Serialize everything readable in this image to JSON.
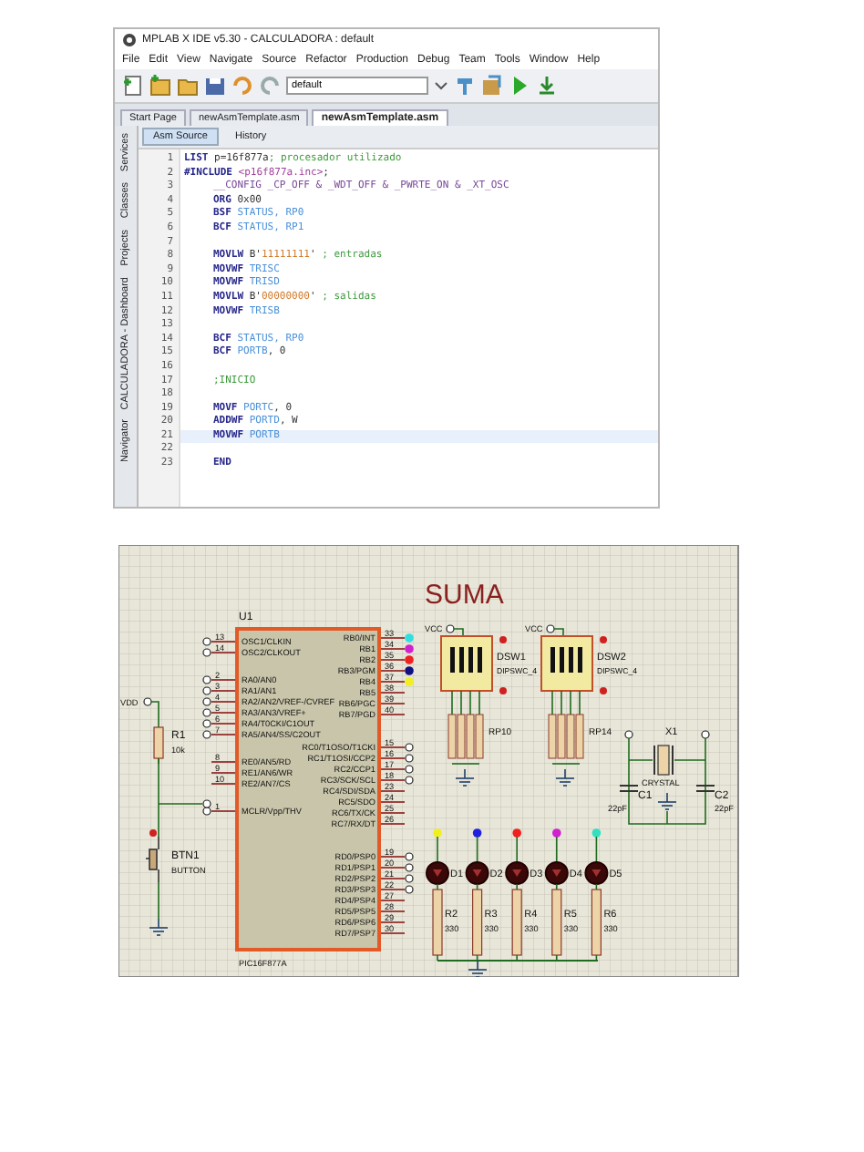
{
  "ide": {
    "title": "MPLAB X IDE v5.30 - CALCULADORA : default",
    "menu": [
      "File",
      "Edit",
      "View",
      "Navigate",
      "Source",
      "Refactor",
      "Production",
      "Debug",
      "Team",
      "Tools",
      "Window",
      "Help"
    ],
    "config_field": {
      "value": "default"
    },
    "file_tabs": [
      {
        "label": "Start Page",
        "selected": false
      },
      {
        "label": "newAsmTemplate.asm",
        "selected": false
      },
      {
        "label": "newAsmTemplate.asm",
        "selected": true
      }
    ],
    "view_tabs": [
      {
        "label": "Asm Source",
        "selected": true
      },
      {
        "label": "History",
        "selected": false
      }
    ],
    "side_tabs": [
      "Services",
      "Classes",
      "Projects",
      "CALCULADORA - Dashboard",
      "Navigator"
    ],
    "code_lines": [
      {
        "number": "1",
        "indent": false,
        "selected": false,
        "tokens": [
          {
            "kind": "keyword",
            "text": "LIST"
          },
          {
            "kind": "plain",
            "text": " p=16f877a"
          },
          {
            "kind": "comment",
            "text": "; procesador utilizado"
          }
        ]
      },
      {
        "number": "2",
        "indent": false,
        "selected": false,
        "tokens": [
          {
            "kind": "keyword",
            "text": "#INCLUDE"
          },
          {
            "kind": "include",
            "text": " <p16f877a.inc>"
          },
          {
            "kind": "plain",
            "text": ";"
          }
        ]
      },
      {
        "number": "3",
        "indent": true,
        "selected": false,
        "tokens": [
          {
            "kind": "directive",
            "text": "__CONFIG _CP_OFF & _WDT_OFF & _PWRTE_ON & _XT_OSC"
          }
        ]
      },
      {
        "number": "4",
        "indent": true,
        "selected": false,
        "tokens": [
          {
            "kind": "keyword",
            "text": "ORG"
          },
          {
            "kind": "plain",
            "text": " 0x00"
          }
        ]
      },
      {
        "number": "5",
        "indent": true,
        "selected": false,
        "tokens": [
          {
            "kind": "keyword",
            "text": "BSF"
          },
          {
            "kind": "register",
            "text": " STATUS, RP0"
          }
        ]
      },
      {
        "number": "6",
        "indent": true,
        "selected": false,
        "tokens": [
          {
            "kind": "keyword",
            "text": "BCF"
          },
          {
            "kind": "register",
            "text": " STATUS, RP1"
          }
        ]
      },
      {
        "number": "7",
        "selected": false
      },
      {
        "number": "8",
        "indent": true,
        "selected": false,
        "tokens": [
          {
            "kind": "keyword",
            "text": "MOVLW"
          },
          {
            "kind": "plain",
            "text": " B'"
          },
          {
            "kind": "string",
            "text": "11111111"
          },
          {
            "kind": "plain",
            "text": "'"
          },
          {
            "kind": "comment",
            "text": " ; entradas"
          }
        ]
      },
      {
        "number": "9",
        "indent": true,
        "selected": false,
        "tokens": [
          {
            "kind": "keyword",
            "text": "MOVWF"
          },
          {
            "kind": "register",
            "text": " TRISC"
          }
        ]
      },
      {
        "number": "10",
        "indent": true,
        "selected": false,
        "tokens": [
          {
            "kind": "keyword",
            "text": "MOVWF"
          },
          {
            "kind": "register",
            "text": " TRISD"
          }
        ]
      },
      {
        "number": "11",
        "indent": true,
        "selected": false,
        "tokens": [
          {
            "kind": "keyword",
            "text": "MOVLW"
          },
          {
            "kind": "plain",
            "text": " B'"
          },
          {
            "kind": "string",
            "text": "00000000"
          },
          {
            "kind": "plain",
            "text": "'"
          },
          {
            "kind": "comment",
            "text": " ; salidas"
          }
        ]
      },
      {
        "number": "12",
        "indent": true,
        "selected": false,
        "tokens": [
          {
            "kind": "keyword",
            "text": "MOVWF"
          },
          {
            "kind": "register",
            "text": " TRISB"
          }
        ]
      },
      {
        "number": "13",
        "selected": false
      },
      {
        "number": "14",
        "indent": true,
        "selected": false,
        "tokens": [
          {
            "kind": "keyword",
            "text": "BCF"
          },
          {
            "kind": "register",
            "text": " STATUS, RP0"
          }
        ]
      },
      {
        "number": "15",
        "indent": true,
        "selected": false,
        "tokens": [
          {
            "kind": "keyword",
            "text": "BCF"
          },
          {
            "kind": "register",
            "text": " PORTB"
          },
          {
            "kind": "plain",
            "text": ", 0"
          }
        ]
      },
      {
        "number": "16",
        "selected": false
      },
      {
        "number": "17",
        "indent": true,
        "selected": false,
        "tokens": [
          {
            "kind": "comment",
            "text": ";INICIO"
          }
        ]
      },
      {
        "number": "18",
        "selected": false
      },
      {
        "number": "19",
        "indent": true,
        "selected": false,
        "tokens": [
          {
            "kind": "keyword",
            "text": "MOVF"
          },
          {
            "kind": "register",
            "text": " PORTC"
          },
          {
            "kind": "plain",
            "text": ", 0"
          }
        ]
      },
      {
        "number": "20",
        "indent": true,
        "selected": false,
        "tokens": [
          {
            "kind": "keyword",
            "text": "ADDWF"
          },
          {
            "kind": "register",
            "text": " PORTD"
          },
          {
            "kind": "plain",
            "text": ", W"
          }
        ]
      },
      {
        "number": "21",
        "indent": true,
        "selected": true,
        "tokens": [
          {
            "kind": "keyword",
            "text": "MOVWF"
          },
          {
            "kind": "register",
            "text": " PORTB"
          }
        ]
      },
      {
        "number": "22",
        "selected": false
      },
      {
        "number": "23",
        "indent": true,
        "selected": false,
        "tokens": [
          {
            "kind": "keyword",
            "text": "END"
          }
        ]
      }
    ]
  },
  "schematic": {
    "title": "SUMA",
    "chip": {
      "ref": "U1",
      "part": "PIC16F877A",
      "left_pin_groups": [
        [
          {
            "number": "13",
            "name": "OSC1/CLKIN"
          },
          {
            "number": "14",
            "name": "OSC2/CLKOUT"
          }
        ],
        [
          {
            "number": "2",
            "name": "RA0/AN0"
          },
          {
            "number": "3",
            "name": "RA1/AN1"
          },
          {
            "number": "4",
            "name": "RA2/AN2/VREF-/CVREF"
          },
          {
            "number": "5",
            "name": "RA3/AN3/VREF+"
          },
          {
            "number": "6",
            "name": "RA4/T0CKI/C1OUT"
          },
          {
            "number": "7",
            "name": "RA5/AN4/SS/C2OUT"
          }
        ],
        [
          {
            "number": "8",
            "name": "RE0/AN5/RD"
          },
          {
            "number": "9",
            "name": "RE1/AN6/WR"
          },
          {
            "number": "10",
            "name": "RE2/AN7/CS"
          }
        ],
        [
          {
            "number": "1",
            "name": "MCLR/Vpp/THV"
          }
        ]
      ],
      "right_pin_groups": [
        [
          {
            "number": "33",
            "name": "RB0/INT",
            "color": "#30e0e0"
          },
          {
            "number": "34",
            "name": "RB1",
            "color": "#d020d0"
          },
          {
            "number": "35",
            "name": "RB2",
            "color": "#f02020"
          },
          {
            "number": "36",
            "name": "RB3/PGM",
            "color": "#101080"
          },
          {
            "number": "37",
            "name": "RB4",
            "color": "#f0f020"
          },
          {
            "number": "38",
            "name": "RB5"
          },
          {
            "number": "39",
            "name": "RB6/PGC"
          },
          {
            "number": "40",
            "name": "RB7/PGD"
          }
        ],
        [
          {
            "number": "15",
            "name": "RC0/T1OSO/T1CKI"
          },
          {
            "number": "16",
            "name": "RC1/T1OSI/CCP2"
          },
          {
            "number": "17",
            "name": "RC2/CCP1"
          },
          {
            "number": "18",
            "name": "RC3/SCK/SCL"
          },
          {
            "number": "23",
            "name": "RC4/SDI/SDA"
          },
          {
            "number": "24",
            "name": "RC5/SDO"
          },
          {
            "number": "25",
            "name": "RC6/TX/CK"
          },
          {
            "number": "26",
            "name": "RC7/RX/DT"
          }
        ],
        [
          {
            "number": "19",
            "name": "RD0/PSP0"
          },
          {
            "number": "20",
            "name": "RD1/PSP1"
          },
          {
            "number": "21",
            "name": "RD2/PSP2"
          },
          {
            "number": "22",
            "name": "RD3/PSP3"
          },
          {
            "number": "27",
            "name": "RD4/PSP4"
          },
          {
            "number": "28",
            "name": "RD5/PSP5"
          },
          {
            "number": "29",
            "name": "RD6/PSP6"
          },
          {
            "number": "30",
            "name": "RD7/PSP7"
          }
        ]
      ]
    },
    "supply_label": "VDD",
    "pullup": {
      "ref": "R1",
      "value": "10k"
    },
    "button": {
      "ref": "BTN1",
      "part": "BUTTON"
    },
    "dip_switches": [
      {
        "ref": "DSW1",
        "part": "DIPSWC_4",
        "supply": "VCC",
        "switches": [
          {
            "on": true
          },
          {
            "on": true
          },
          {
            "on": true
          },
          {
            "on": true
          }
        ]
      },
      {
        "ref": "DSW2",
        "part": "DIPSWC_4",
        "supply": "VCC",
        "switches": [
          {
            "on": true
          },
          {
            "on": true
          },
          {
            "on": true
          },
          {
            "on": true
          }
        ]
      }
    ],
    "resistor_packs": [
      {
        "ref": "RP10"
      },
      {
        "ref": "RP14"
      }
    ],
    "crystal": {
      "ref": "X1",
      "part": "CRYSTAL"
    },
    "capacitors": [
      {
        "ref": "C1",
        "value": "22pF"
      },
      {
        "ref": "C2",
        "value": "22pF"
      }
    ],
    "leds": [
      {
        "ref": "D1",
        "color": "#f0f020"
      },
      {
        "ref": "D2",
        "color": "#2020e0"
      },
      {
        "ref": "D3",
        "color": "#f02020"
      },
      {
        "ref": "D4",
        "color": "#d020d0"
      },
      {
        "ref": "D5",
        "color": "#30e0c0"
      }
    ],
    "resistors": [
      {
        "ref": "R2",
        "value": "330"
      },
      {
        "ref": "R3",
        "value": "330"
      },
      {
        "ref": "R4",
        "value": "330"
      },
      {
        "ref": "R5",
        "value": "330"
      },
      {
        "ref": "R6",
        "value": "330"
      }
    ]
  }
}
